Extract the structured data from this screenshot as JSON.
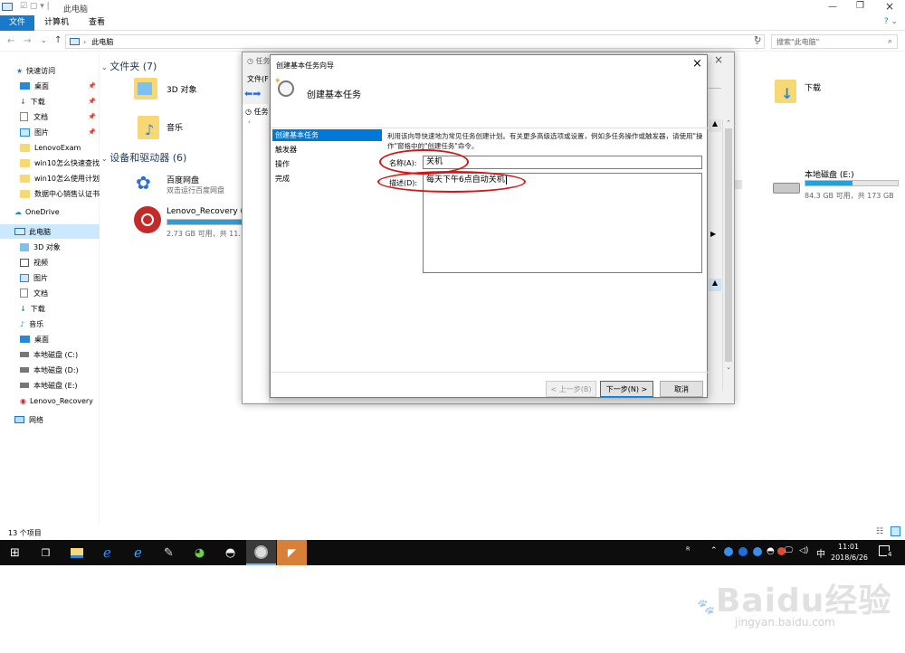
{
  "window": {
    "title": "此电脑"
  },
  "ribbon": {
    "tabs": [
      "文件",
      "计算机",
      "查看"
    ]
  },
  "address": {
    "path": "此电脑",
    "search_placeholder": "搜索\"此电脑\""
  },
  "nav": {
    "quick_access": "快速访问",
    "qa_items": [
      "桌面",
      "下载",
      "文档",
      "图片",
      "LenovoExam",
      "win10怎么快速查找",
      "win10怎么使用计划",
      "数据中心销售认证书"
    ],
    "onedrive": "OneDrive",
    "thispc": "此电脑",
    "pc_items": [
      "3D 对象",
      "视频",
      "图片",
      "文档",
      "下载",
      "音乐",
      "桌面",
      "本地磁盘 (C:)",
      "本地磁盘 (D:)",
      "本地磁盘 (E:)",
      "Lenovo_Recovery"
    ],
    "network": "网络"
  },
  "content": {
    "folders_header": "文件夹 (7)",
    "folders": [
      "3D 对象",
      "音乐",
      "下载"
    ],
    "devices_header": "设备和驱动器 (6)",
    "baidu": {
      "name": "百度网盘",
      "sub": "双击运行百度网盘"
    },
    "recovery": {
      "name": "Lenovo_Recovery (F:)",
      "space": "2.73 GB 可用，共 11.",
      "fill": 0.8
    },
    "disk_e": {
      "name": "本地磁盘 (E:)",
      "space": "84.3 GB 可用，共 173 GB",
      "fill": 0.51
    }
  },
  "status": {
    "count": "13 个项目"
  },
  "taskbar": {
    "ime": "中",
    "time": "11:01",
    "date": "2018/6/26",
    "notif_count": "4"
  },
  "ts_back": {
    "title": "任务",
    "menu": "文件(F",
    "tree": "任务"
  },
  "wizard": {
    "title": "创建基本任务向导",
    "header": "创建基本任务",
    "steps": [
      "创建基本任务",
      "触发器",
      "操作",
      "完成"
    ],
    "intro": "利用该向导快速地为常见任务创建计划。有关更多高级选项或设置，例如多任务操作或触发器，请使用\"操作\"窗格中的\"创建任务\"命令。",
    "name_label": "名称(A):",
    "name_value": "关机",
    "desc_label": "描述(D):",
    "desc_value": "每天下午6点自动关机",
    "back_btn": "< 上一步(B)",
    "next_btn": "下一步(N) >",
    "cancel_btn": "取消",
    "close": "×"
  },
  "watermark": {
    "logo": "Baidu经验",
    "url": "jingyan.baidu.com"
  },
  "colors": {
    "accent": "#0078d7",
    "annotation": "#d11818",
    "folder": "#f8d775",
    "taskbar": "#0d0d0d"
  }
}
